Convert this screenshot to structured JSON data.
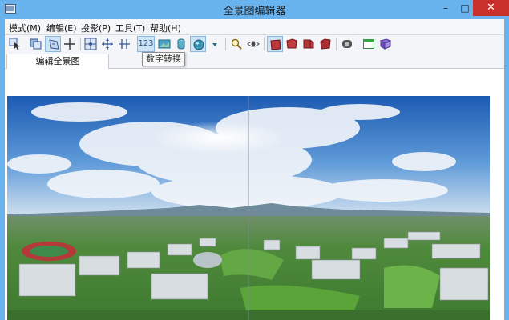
{
  "window": {
    "title": "全景图编辑器",
    "controls": {
      "minimize": "–",
      "maximize": "□",
      "close": "✕"
    }
  },
  "menu": {
    "items": [
      {
        "label": "模式(M)"
      },
      {
        "label": "编辑(E)"
      },
      {
        "label": "投影(P)"
      },
      {
        "label": "工具(T)"
      },
      {
        "label": "帮助(H)"
      }
    ]
  },
  "toolbar": {
    "number_button_label": "123",
    "tooltip": "数字转换",
    "icons": [
      "select-arrow-icon",
      "copy-layers-icon",
      "rotate-select-icon",
      "crosshair-icon",
      "grid-icon",
      "move-point-icon",
      "split-icon",
      "number-convert-icon",
      "image-icon",
      "cylinder-icon",
      "sphere-icon",
      "dropdown-icon",
      "zoom-icon",
      "eye-icon",
      "cube-face-1-icon",
      "cube-face-2-icon",
      "cube-face-3-icon",
      "cube-face-4-icon",
      "badge-icon",
      "window-icon",
      "book-icon"
    ]
  },
  "tabs": [
    {
      "label": "编辑全景图"
    }
  ],
  "colors": {
    "titlebar": "#68b2ee",
    "close_button": "#c9302c",
    "sky_top": "#1f5fb5",
    "ground": "#4f8a3c"
  }
}
